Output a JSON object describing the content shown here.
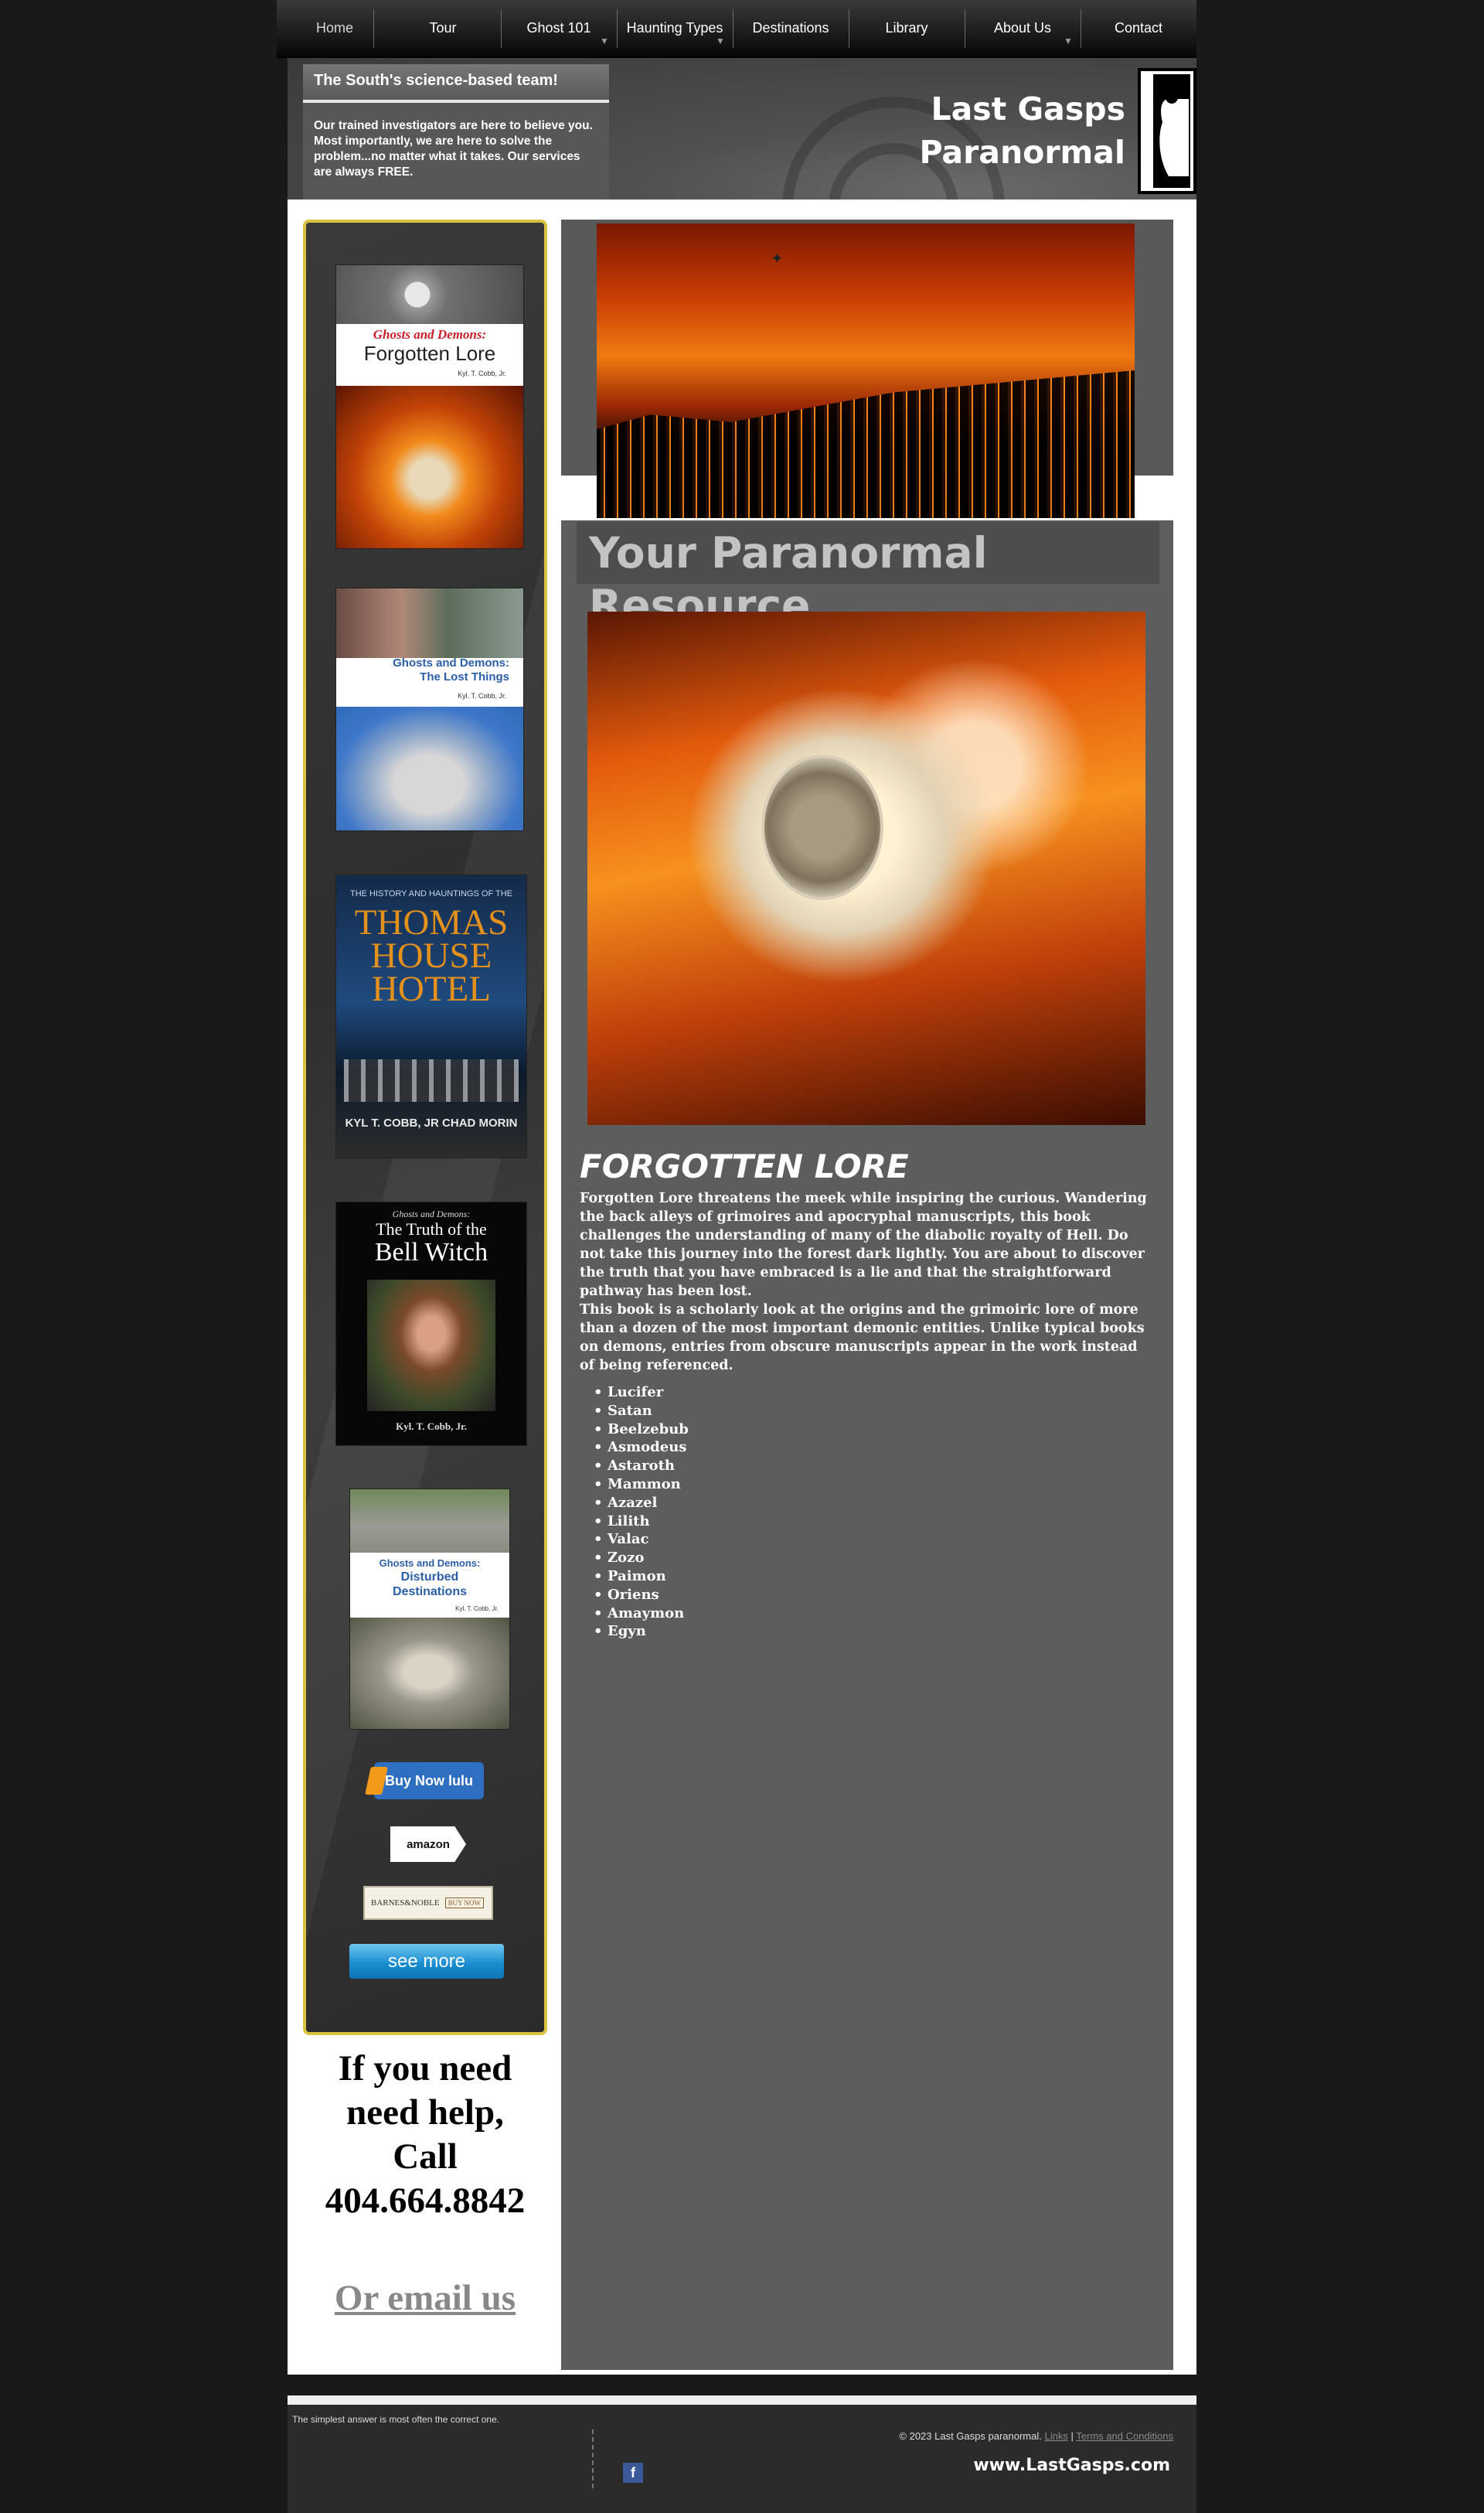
{
  "nav": {
    "items": [
      {
        "label": "Home"
      },
      {
        "label": "Tour"
      },
      {
        "label": "Ghost 101"
      },
      {
        "label": "Haunting Types"
      },
      {
        "label": "Destinations"
      },
      {
        "label": "Library"
      },
      {
        "label": "About Us"
      },
      {
        "label": "Contact"
      }
    ],
    "active": "Home",
    "dropdown_icon": "triangle-down"
  },
  "header": {
    "promo_title": "The South's science-based team!",
    "promo_text": "Our trained investigators are here to believe you.  Most importantly, we are here to solve the problem...no  matter what it takes. Our services are always FREE.",
    "brand_line1": "Last Gasps",
    "brand_line2": "Paranormal"
  },
  "sidebar": {
    "books": [
      {
        "line1": "Ghosts and Demons:",
        "line2": "Forgotten Lore",
        "author": "Kyl. T. Cobb, Jr."
      },
      {
        "line1": "Ghosts and Demons:",
        "line2": "The Lost Things",
        "author": "Kyl. T. Cobb, Jr."
      },
      {
        "line0": "THE HISTORY AND HAUNTINGS OF THE",
        "line1": "THOMAS",
        "line2": "HOUSE",
        "line3": "HOTEL",
        "author": "KYL T. COBB, JR    CHAD MORIN"
      },
      {
        "line0": "Ghosts and Demons:",
        "line1": "The Truth of the",
        "line2": "Bell Witch",
        "author": "Kyl. T. Cobb, Jr."
      },
      {
        "line1": "Ghosts and Demons:",
        "line2": "Disturbed",
        "line3": "Destinations",
        "author": "Kyl. T. Cobb, Jr."
      }
    ],
    "lulu_label": "Buy Now lulu",
    "amazon_label": "amazon",
    "bn_label": "BARNES&NOBLE",
    "bn_buy": "BUY NOW",
    "see_more": "see more"
  },
  "help": {
    "line1": "If you need",
    "line2": "need help,",
    "line3": "Call",
    "phone": "404.664.8842",
    "email_link": "Or email us"
  },
  "content": {
    "title": "Your Paranormal Resource",
    "book_heading": "FORGOTTEN LORE",
    "paragraph1": "Forgotten Lore threatens the meek while inspiring the curious. Wandering the back alleys of grimoires and apocryphal manuscripts, this book challenges the understanding of many of the diabolic royalty of Hell. Do not take this journey into the forest dark lightly. You are about to discover the truth that you have embraced is a lie and that the straightforward pathway has been lost.",
    "paragraph2": "This book is a scholarly look at the origins and the grimoiric lore of more than a dozen of the most important demonic entities. Unlike typical books on demons, entries from obscure manuscripts appear in the work instead of being referenced.",
    "demons": [
      "Lucifer",
      "Satan",
      "Beelzebub",
      "Asmodeus",
      "Astaroth",
      "Mammon",
      "Azazel",
      "Lilith",
      "Valac",
      "Zozo",
      "Paimon",
      "Oriens",
      "Amaymon",
      "Egyn"
    ]
  },
  "footer": {
    "tagline": "The simplest answer is most often the correct one.",
    "copyright": "© 2023  Last Gasps paranormal.",
    "links": "Links",
    "separator": "|",
    "terms": "Terms and Conditions",
    "site": "www.LastGasps.com",
    "facebook": "f"
  },
  "colors": {
    "page_bg": "#191919",
    "panel_gray": "#5d5d5d",
    "sidebar_border": "#d9c23f",
    "email_link": "#888888",
    "see_more_blue": "#1b8fd1"
  }
}
